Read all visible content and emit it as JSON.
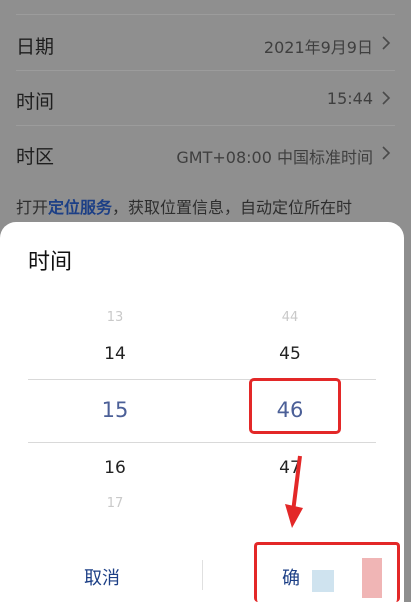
{
  "settings": {
    "rows": [
      {
        "label": "日期",
        "value": "2021年9月9日"
      },
      {
        "label": "时间",
        "value": "15:44"
      },
      {
        "label": "时区",
        "value": "GMT+08:00 中国标准时间"
      }
    ],
    "info": {
      "prefix": "打开",
      "link": "定位服务",
      "suffix": "，获取位置信息，自动定位所在时"
    }
  },
  "picker": {
    "title": "时间",
    "hours": {
      "above2": "13",
      "above1": "14",
      "selected": "15",
      "below1": "16",
      "below2": "17"
    },
    "minutes": {
      "above2": "44",
      "above1": "45",
      "selected": "46",
      "below1": "47"
    },
    "cancel_label": "取消",
    "confirm_label": "确"
  },
  "colors": {
    "accent": "#1c3f86",
    "highlight": "#e32828",
    "selected_value": "#4b5f97"
  }
}
